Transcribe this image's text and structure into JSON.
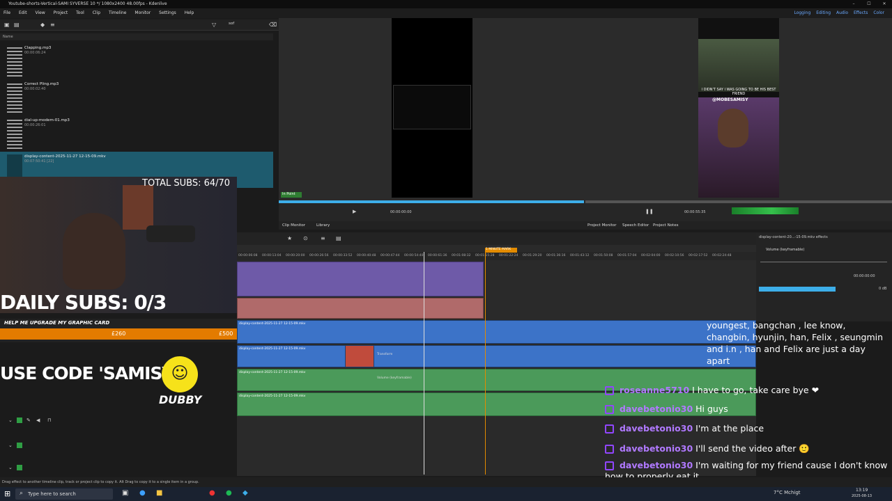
{
  "window": {
    "title": "Youtube-shorts-Vertical-SAMI SYVERSE 10 */ 1080x2400 48.00fps - Kdenlive",
    "minimize": "–",
    "maximize": "☐",
    "close": "✕"
  },
  "menu": [
    "File",
    "Edit",
    "View",
    "Project",
    "Tool",
    "Clip",
    "Timeline",
    "Monitor",
    "Settings",
    "Help"
  ],
  "layouts": [
    "Logging",
    "Editing",
    "Audio",
    "Effects",
    "Color"
  ],
  "bin": {
    "search_value": "sof",
    "header": "Name",
    "clips": [
      {
        "name": "Clapping.mp3",
        "dur": "00:00:06:24"
      },
      {
        "name": "Correct Pling.mp3",
        "dur": "00:00:02:40"
      },
      {
        "name": "dial-up-modem-01.mp3",
        "dur": "00:00:26:01"
      },
      {
        "name": "display-content-2025-11-27 12-15-09.mkv",
        "dur": "00:07:50:41 [22]"
      }
    ]
  },
  "clip_monitor": {
    "badge": "In Point",
    "timecode": "00:00:00:00",
    "tab_clip": "Clip Monitor",
    "tab_library": "Library"
  },
  "project_monitor": {
    "timecode": "00:00:55:35",
    "tab_project": "Project Monitor",
    "tab_speech": "Speech Editor",
    "tab_notes": "Project Notes",
    "caption": "I DIDN'T SAY I WAS GOING TO BE HIS BEST FRIEND",
    "handle": "@MOBESAMISY"
  },
  "timeline": {
    "marker": "1 MINUTE MARK",
    "ruler": [
      "00:00:06:08",
      "00:00:13:04",
      "00:00:20:00",
      "00:00:26:56",
      "00:00:33:52",
      "00:00:40:48",
      "00:00:47:44",
      "00:00:54:40",
      "00:00:61:36",
      "00:01:08:32",
      "00:01:15:28",
      "00:01:22:24",
      "00:01:29:20",
      "00:01:36:16",
      "00:01:43:12",
      "00:01:50:08",
      "00:01:57:04",
      "00:02:04:00",
      "00:02:10:56",
      "00:02:17:52",
      "00:02:24:48"
    ],
    "clip_label": "display-content-2025-11-27 12-15-09.mkv",
    "effect_transform": "Transform",
    "effect_volume": "Volume (keyframable)"
  },
  "effects": {
    "title": "display-content-20...-15-09.mkv effects",
    "effect": "Volume (keyframable)",
    "timecode": "00:00:00:00",
    "value": "0 dB"
  },
  "overlay": {
    "total_subs": "TOTAL SUBS: 64/70",
    "daily_subs": "DAILY SUBS: 0/3",
    "goal_title": "HELP ME UPGRADE MY GRAPHIC CARD",
    "goal_current": "£260",
    "goal_target": "£500",
    "code": "USE CODE 'SAMISY'",
    "sponsor": "DUBBY"
  },
  "chat": [
    {
      "user": "",
      "msg": "youngest, bangchan , lee know, changbin, hyunjin, han, Felix , seungmin and i.n , han and Felix are just a day apart"
    },
    {
      "user": "roseanne5710",
      "msg": "I have to go, take care bye ❤"
    },
    {
      "user": "davebetonio30",
      "msg": "Hi guys"
    },
    {
      "user": "davebetonio30",
      "msg": "I'm at the place"
    },
    {
      "user": "davebetonio30",
      "msg": "I'll send the video after 🙂"
    },
    {
      "user": "davebetonio30",
      "msg": "I'm waiting for my friend cause I don't know how to properly eat it"
    }
  ],
  "status": "Drag effect to another timeline clip, track or project clip to copy it. Alt Drag to copy it to a single item in a group.",
  "taskbar": {
    "search": "Type here to search",
    "weather": "7°C Mchigt",
    "time": "13:19",
    "date": "2025-08-13"
  },
  "colors": {
    "accent": "#3daee9",
    "clip_blue": "#3c73c8",
    "audio_green": "#4b9a5a",
    "purple": "#6e5aa8",
    "red_clip": "#c04b3c",
    "twitch": "#9146ff"
  }
}
